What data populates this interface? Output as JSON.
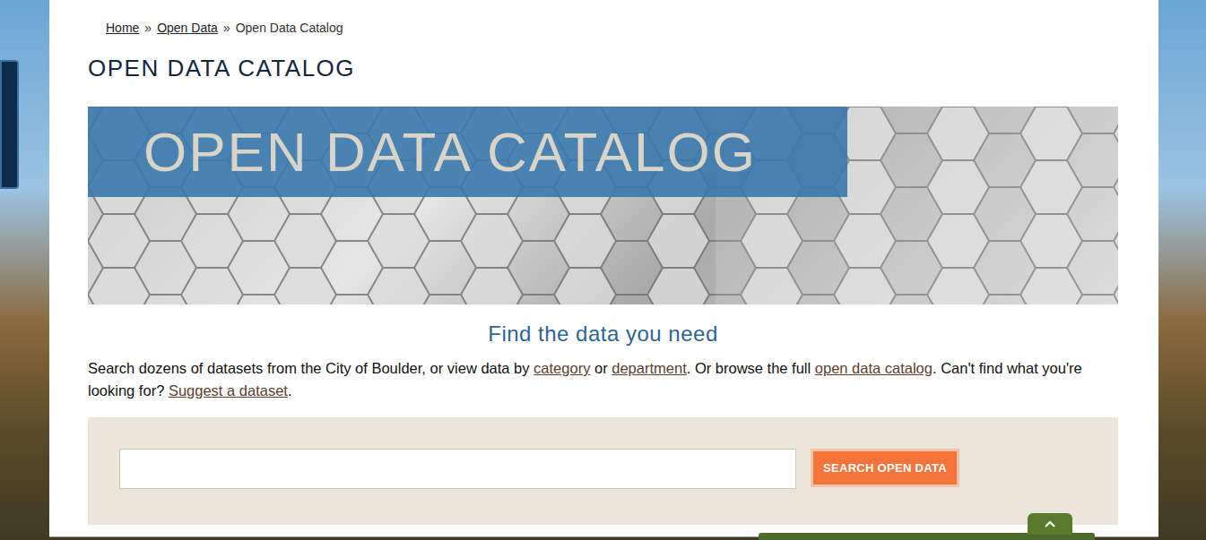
{
  "breadcrumb": {
    "separator": "»",
    "items": [
      {
        "label": "Home",
        "kind": "link"
      },
      {
        "label": "Open Data",
        "kind": "link"
      },
      {
        "label": "Open Data Catalog",
        "kind": "text"
      }
    ]
  },
  "page": {
    "title": "OPEN DATA CATALOG"
  },
  "banner": {
    "title": "OPEN DATA CATALOG"
  },
  "finder": {
    "heading": "Find the data you need",
    "intro": [
      {
        "text": "Search dozens of datasets from the City of Boulder, or view data by ",
        "kind": "text"
      },
      {
        "text": "category",
        "kind": "link"
      },
      {
        "text": " or ",
        "kind": "text"
      },
      {
        "text": "department",
        "kind": "link"
      },
      {
        "text": ". Or browse the full ",
        "kind": "text"
      },
      {
        "text": "open data catalog",
        "kind": "link"
      },
      {
        "text": ". Can't find what you're looking for? ",
        "kind": "text"
      },
      {
        "text": "Suggest a dataset",
        "kind": "link"
      },
      {
        "text": ".",
        "kind": "text"
      }
    ]
  },
  "search": {
    "placeholder": "",
    "button": "SEARCH OPEN DATA"
  }
}
